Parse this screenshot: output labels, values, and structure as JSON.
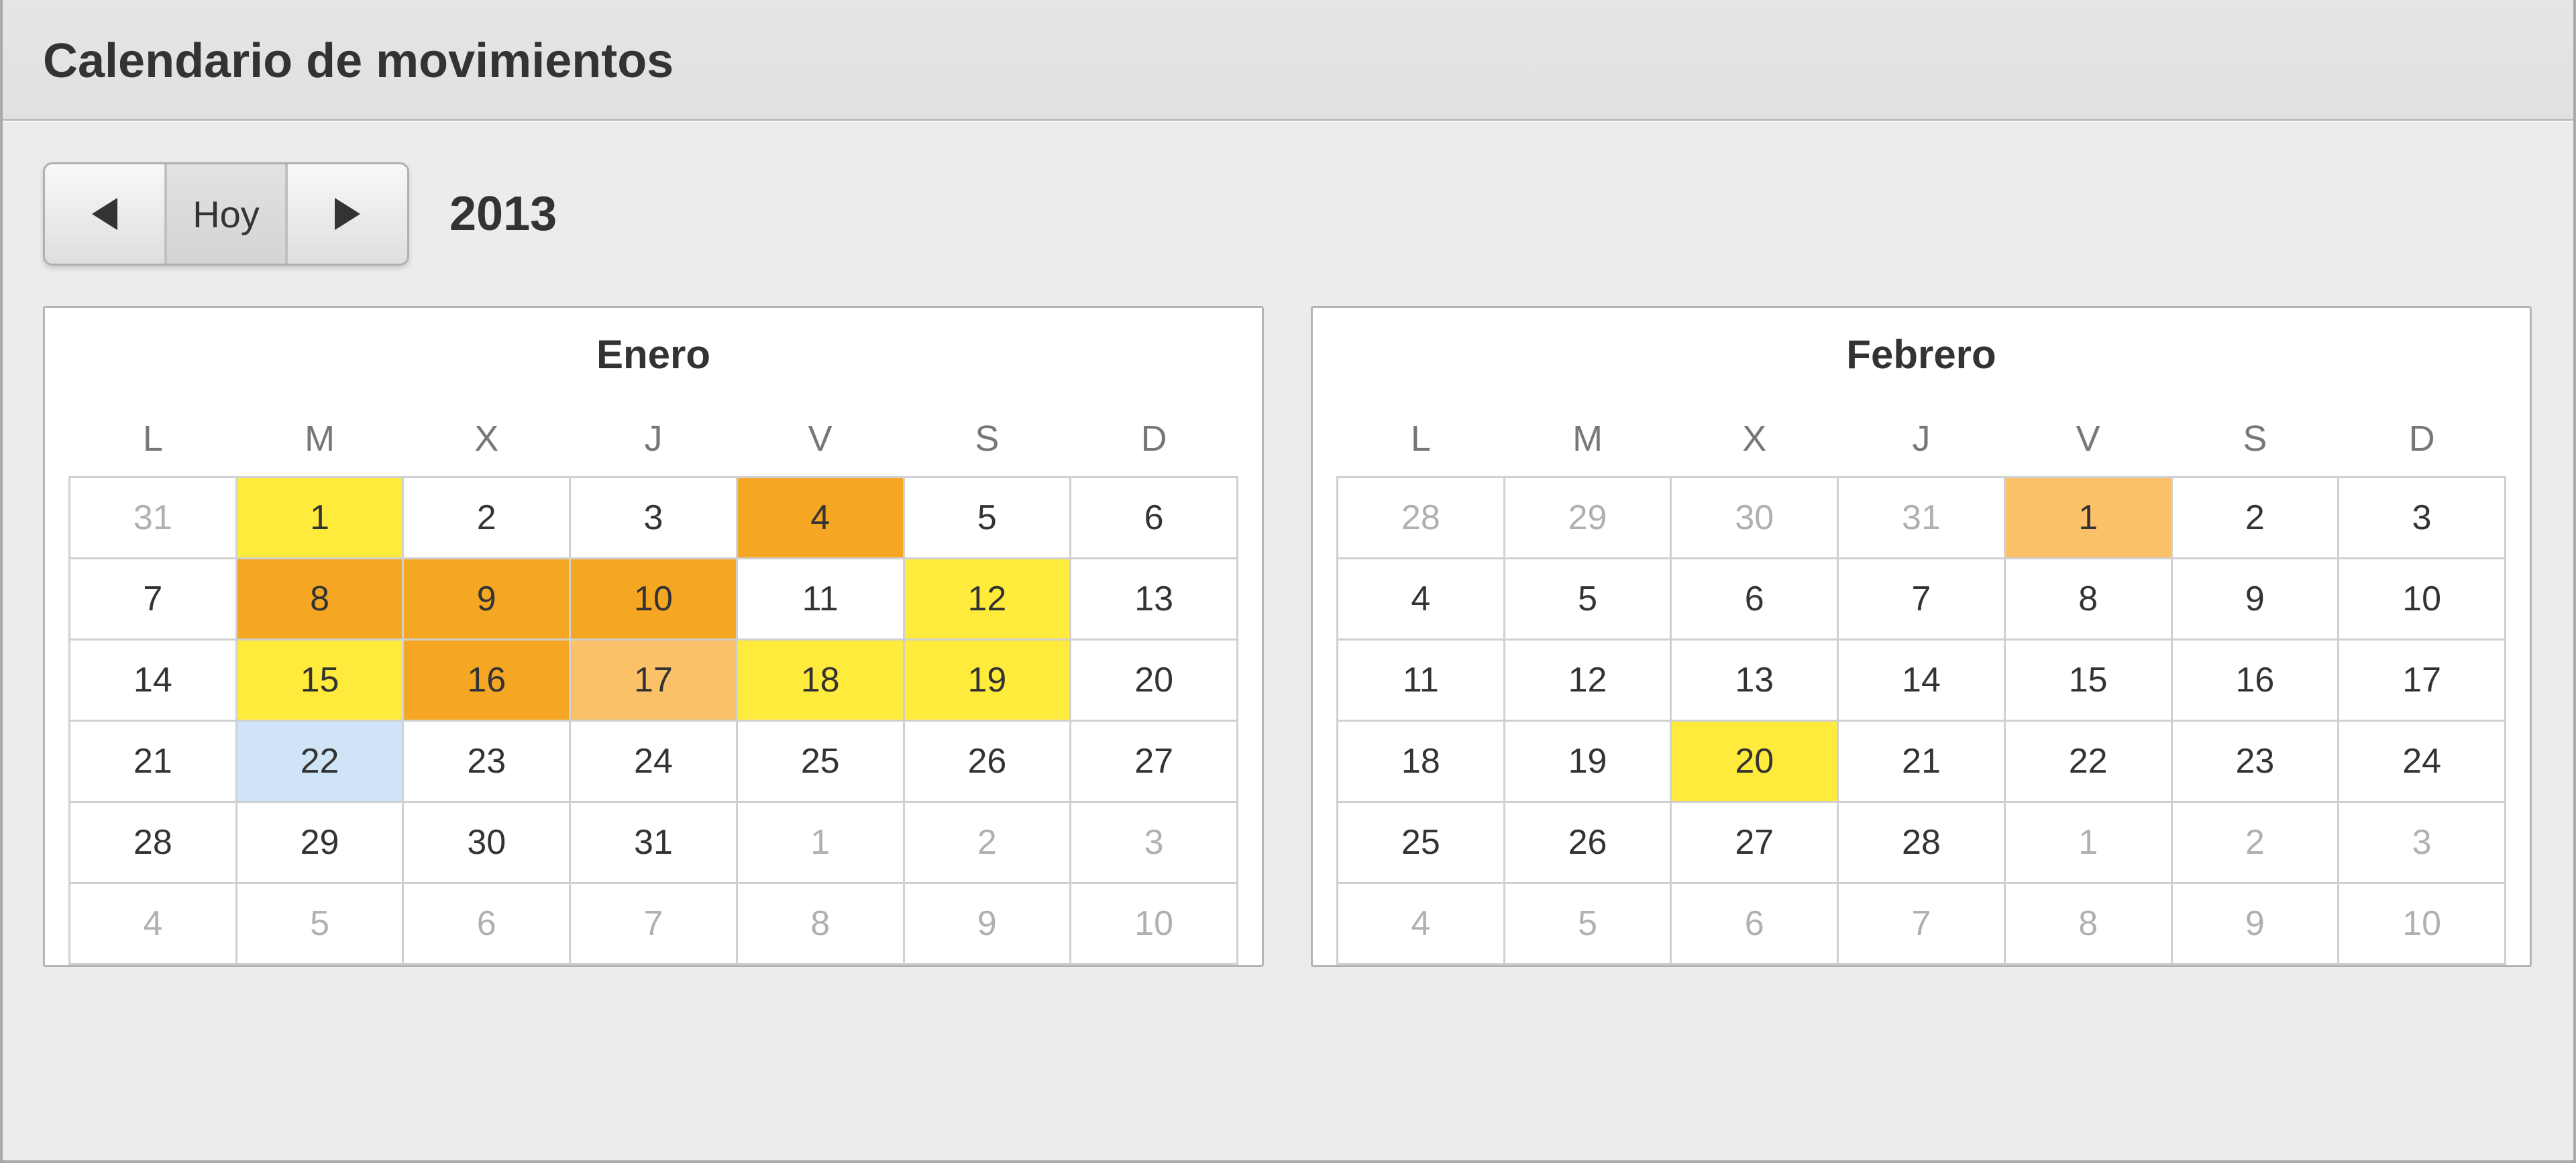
{
  "header": {
    "title": "Calendario de movimientos"
  },
  "toolbar": {
    "today_label": "Hoy",
    "year_label": "2013"
  },
  "colors": {
    "yellow": "#ffeb3b",
    "paleyellow": "#ffe762",
    "orange": "#f5a623",
    "lightorange": "#fac168",
    "blue": "#cfe5f7"
  },
  "day_headers": [
    "L",
    "M",
    "X",
    "J",
    "V",
    "S",
    "D"
  ],
  "months": [
    {
      "name": "Enero",
      "weeks": [
        [
          {
            "d": 31,
            "other": true
          },
          {
            "d": 1,
            "hl": "yellow"
          },
          {
            "d": 2
          },
          {
            "d": 3
          },
          {
            "d": 4,
            "hl": "orange"
          },
          {
            "d": 5
          },
          {
            "d": 6
          }
        ],
        [
          {
            "d": 7
          },
          {
            "d": 8,
            "hl": "orange"
          },
          {
            "d": 9,
            "hl": "orange"
          },
          {
            "d": 10,
            "hl": "orange"
          },
          {
            "d": 11
          },
          {
            "d": 12,
            "hl": "yellow"
          },
          {
            "d": 13
          }
        ],
        [
          {
            "d": 14
          },
          {
            "d": 15,
            "hl": "yellow"
          },
          {
            "d": 16,
            "hl": "orange"
          },
          {
            "d": 17,
            "hl": "lightorange"
          },
          {
            "d": 18,
            "hl": "yellow"
          },
          {
            "d": 19,
            "hl": "yellow"
          },
          {
            "d": 20
          }
        ],
        [
          {
            "d": 21
          },
          {
            "d": 22,
            "hl": "blue"
          },
          {
            "d": 23
          },
          {
            "d": 24
          },
          {
            "d": 25
          },
          {
            "d": 26
          },
          {
            "d": 27
          }
        ],
        [
          {
            "d": 28
          },
          {
            "d": 29
          },
          {
            "d": 30
          },
          {
            "d": 31
          },
          {
            "d": 1,
            "other": true
          },
          {
            "d": 2,
            "other": true
          },
          {
            "d": 3,
            "other": true
          }
        ],
        [
          {
            "d": 4,
            "other": true
          },
          {
            "d": 5,
            "other": true
          },
          {
            "d": 6,
            "other": true
          },
          {
            "d": 7,
            "other": true
          },
          {
            "d": 8,
            "other": true
          },
          {
            "d": 9,
            "other": true
          },
          {
            "d": 10,
            "other": true
          }
        ]
      ]
    },
    {
      "name": "Febrero",
      "weeks": [
        [
          {
            "d": 28,
            "other": true
          },
          {
            "d": 29,
            "other": true
          },
          {
            "d": 30,
            "other": true
          },
          {
            "d": 31,
            "other": true
          },
          {
            "d": 1,
            "hl": "lightorange"
          },
          {
            "d": 2
          },
          {
            "d": 3
          }
        ],
        [
          {
            "d": 4
          },
          {
            "d": 5
          },
          {
            "d": 6
          },
          {
            "d": 7
          },
          {
            "d": 8
          },
          {
            "d": 9
          },
          {
            "d": 10
          }
        ],
        [
          {
            "d": 11
          },
          {
            "d": 12
          },
          {
            "d": 13
          },
          {
            "d": 14
          },
          {
            "d": 15
          },
          {
            "d": 16
          },
          {
            "d": 17
          }
        ],
        [
          {
            "d": 18
          },
          {
            "d": 19
          },
          {
            "d": 20,
            "hl": "yellow"
          },
          {
            "d": 21
          },
          {
            "d": 22
          },
          {
            "d": 23
          },
          {
            "d": 24
          }
        ],
        [
          {
            "d": 25
          },
          {
            "d": 26
          },
          {
            "d": 27
          },
          {
            "d": 28
          },
          {
            "d": 1,
            "other": true
          },
          {
            "d": 2,
            "other": true
          },
          {
            "d": 3,
            "other": true
          }
        ],
        [
          {
            "d": 4,
            "other": true
          },
          {
            "d": 5,
            "other": true
          },
          {
            "d": 6,
            "other": true
          },
          {
            "d": 7,
            "other": true
          },
          {
            "d": 8,
            "other": true
          },
          {
            "d": 9,
            "other": true
          },
          {
            "d": 10,
            "other": true
          }
        ]
      ]
    }
  ]
}
